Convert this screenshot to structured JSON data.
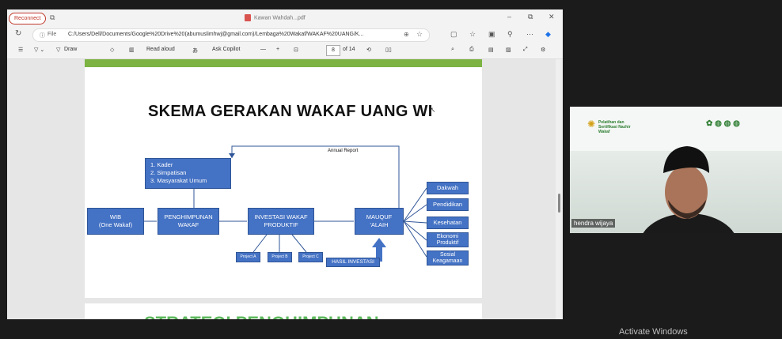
{
  "titlebar": {
    "reconnect_label": "Reconnect",
    "doc_title": "Kawan Wahdah...pdf",
    "minimize": "–",
    "restore": "⧉",
    "close": "✕"
  },
  "addressbar": {
    "file_label": "File",
    "url": "C:/Users/Dell/Documents/Google%20Drive%20(abumuslimhwj@gmail.com)/Lembaga%20Wakaf/WAKAF%20UANG/K..."
  },
  "toolbar": {
    "draw_label": "Draw",
    "read_aloud_label": "Read aloud",
    "ask_copilot_label": "Ask Copilot",
    "page_number": "8",
    "page_total": "of 14",
    "zoom_minus": "—",
    "zoom_plus": "+"
  },
  "slide": {
    "title": "SKEMA GERAKAN WAKAF UANG WI",
    "annual_report": "Annual Report",
    "kader_list": [
      "1.  Kader",
      "2.  Simpatisan",
      "3.  Masyarakat Umum"
    ],
    "wib": "WIB\n(One Wakaf)",
    "penghimpunan": "PENGHIMPUNAN\nWAKAF",
    "investasi": "INVESTASI WAKAF\nPRODUKTIF",
    "mauquf": "MAUQUF\n'ALAIH",
    "hasil": "HASIL INVESTASI",
    "projects": [
      "Project A",
      "Project B",
      "Project C"
    ],
    "beneficiaries": [
      "Dakwah",
      "Pendidikan",
      "Kesehatan",
      "Ekonomi\nProduktif",
      "Sosial\nKeagamaan"
    ]
  },
  "page2": {
    "heading_partial": "STRATEGI PENGHIMPUNAN"
  },
  "video": {
    "participant_name": "hendra wijaya",
    "banner_text": "Pelatihan dan Sertifikasi Nazhir Wakaf"
  },
  "overlay": {
    "activate_windows": "Activate Windows"
  }
}
